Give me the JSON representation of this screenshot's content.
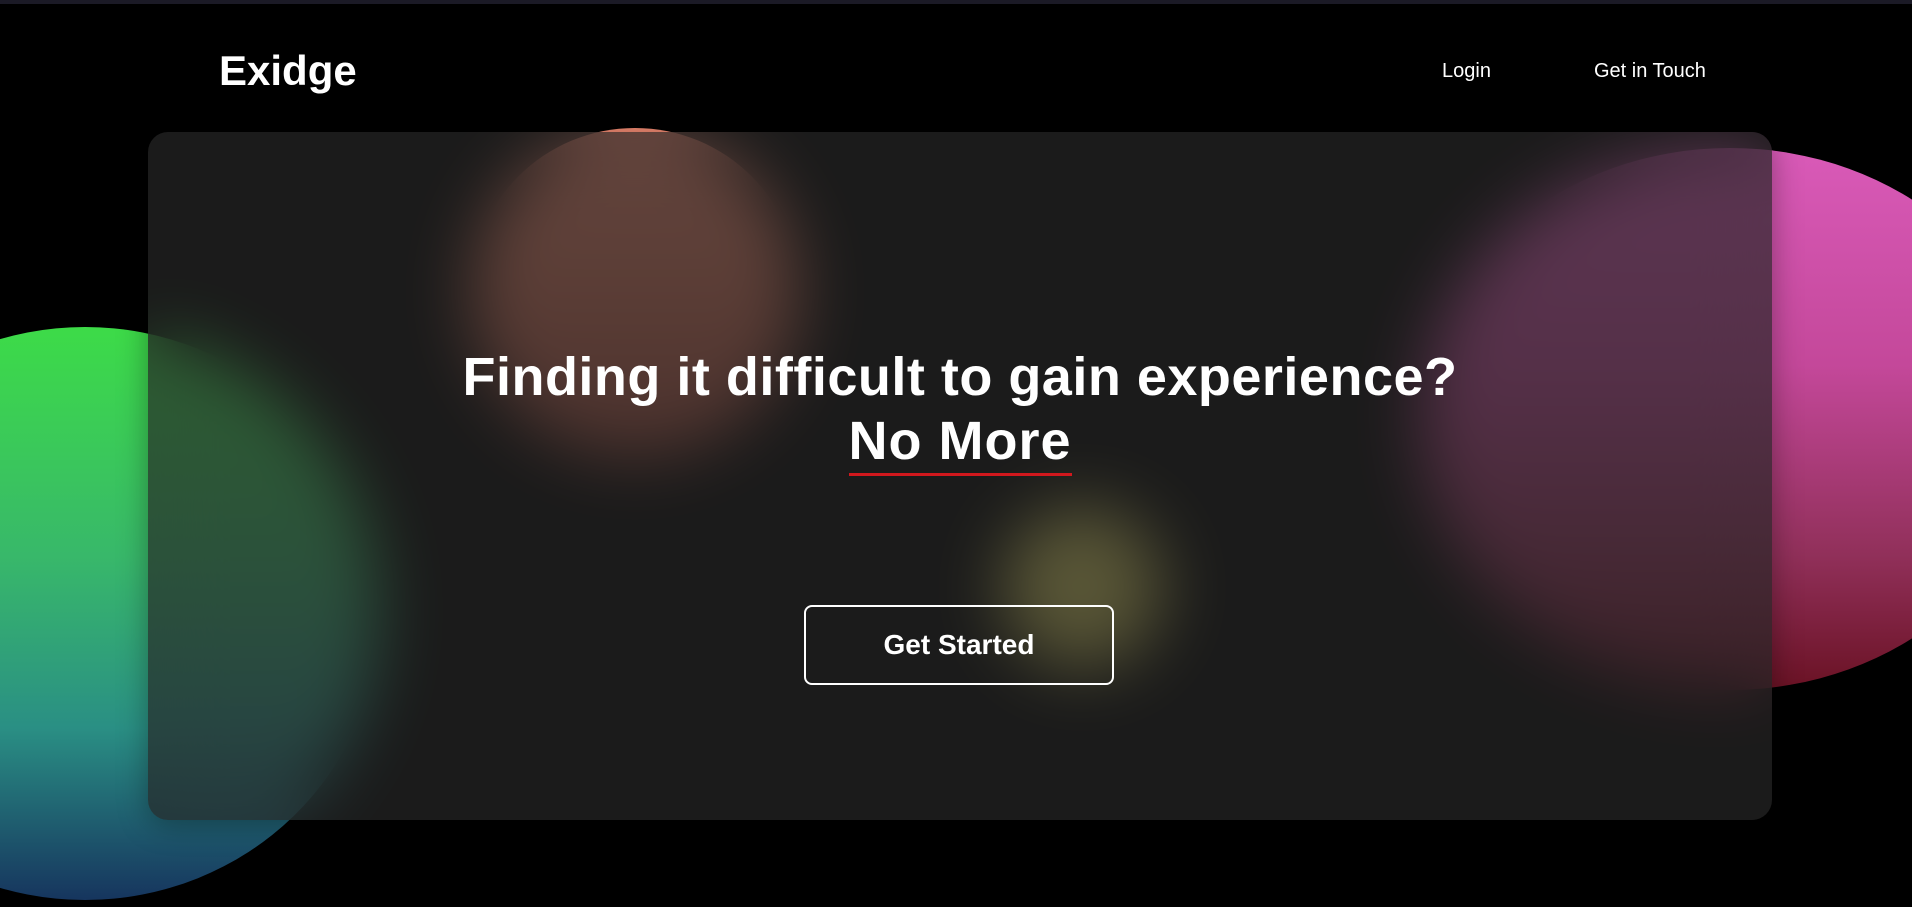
{
  "brand": {
    "logo_text": "Exidge"
  },
  "nav": {
    "items": [
      {
        "label": "Login"
      },
      {
        "label": "Get in Touch"
      }
    ]
  },
  "hero": {
    "headline": "Finding it difficult to gain experience?",
    "highlight": "No More",
    "cta_label": "Get Started"
  },
  "colors": {
    "background": "#000000",
    "card": "#262626",
    "text": "#ffffff",
    "underline_accent": "#d1181d",
    "blob_green": "#3ddb48",
    "blob_pink": "#d95ab8",
    "blob_coral": "#f08a72",
    "blob_yellow": "#dad166"
  }
}
